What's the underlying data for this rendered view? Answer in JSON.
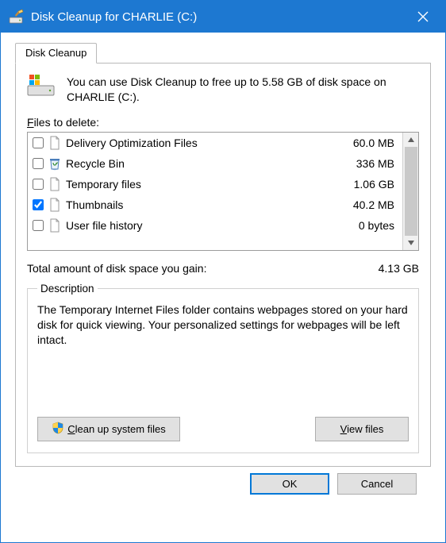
{
  "title": "Disk Cleanup for CHARLIE (C:)",
  "tab": {
    "label": "Disk Cleanup"
  },
  "intro": "You can use Disk Cleanup to free up to 5.58 GB of disk space on CHARLIE (C:).",
  "filesLabel": {
    "u": "F",
    "rest": "iles to delete:"
  },
  "items": [
    {
      "name": "Delivery Optimization Files",
      "size": "60.0 MB",
      "checked": false,
      "icon": "page"
    },
    {
      "name": "Recycle Bin",
      "size": "336 MB",
      "checked": false,
      "icon": "bin"
    },
    {
      "name": "Temporary files",
      "size": "1.06 GB",
      "checked": false,
      "icon": "page"
    },
    {
      "name": "Thumbnails",
      "size": "40.2 MB",
      "checked": true,
      "icon": "page"
    },
    {
      "name": "User file history",
      "size": "0 bytes",
      "checked": false,
      "icon": "page"
    }
  ],
  "total": {
    "label": "Total amount of disk space you gain:",
    "value": "4.13 GB"
  },
  "description": {
    "legend": "Description",
    "text": "The Temporary Internet Files folder contains webpages stored on your hard disk for quick viewing. Your personalized settings for webpages will be left intact."
  },
  "buttons": {
    "cleanup": {
      "u": "C",
      "pre": "",
      "post": "lean up system files"
    },
    "view": {
      "u": "V",
      "pre": "",
      "post": "iew files"
    },
    "ok": "OK",
    "cancel": "Cancel"
  }
}
